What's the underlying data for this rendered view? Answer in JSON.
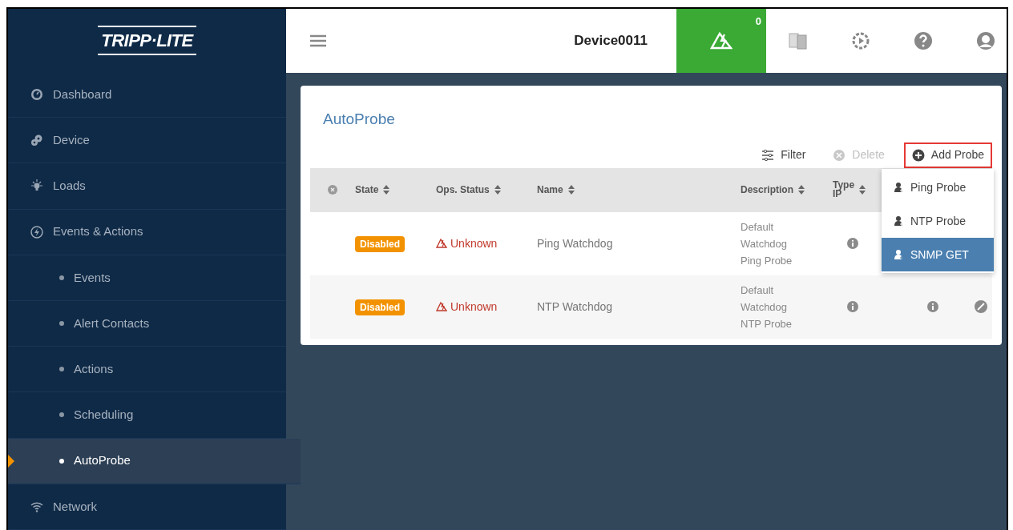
{
  "logo": "TRIPP·LITE",
  "sidebar": {
    "items": [
      {
        "label": "Dashboard",
        "kind": "top",
        "selected": false
      },
      {
        "label": "Device",
        "kind": "top",
        "selected": false
      },
      {
        "label": "Loads",
        "kind": "top",
        "selected": false
      },
      {
        "label": "Events & Actions",
        "kind": "top",
        "selected": false
      },
      {
        "label": "Events",
        "kind": "sub",
        "selected": false
      },
      {
        "label": "Alert Contacts",
        "kind": "sub",
        "selected": false
      },
      {
        "label": "Actions",
        "kind": "sub",
        "selected": false
      },
      {
        "label": "Scheduling",
        "kind": "sub",
        "selected": false
      },
      {
        "label": "AutoProbe",
        "kind": "sub",
        "selected": true
      },
      {
        "label": "Network",
        "kind": "top",
        "selected": false
      }
    ]
  },
  "header": {
    "device": "Device0011",
    "alarm_count": "0"
  },
  "card": {
    "title": "AutoProbe",
    "toolbar": [
      {
        "label": "Filter",
        "kind": "filter",
        "disabled": false,
        "highlighted": false
      },
      {
        "label": "Delete",
        "kind": "delete",
        "disabled": true,
        "highlighted": false
      },
      {
        "label": "Add Probe",
        "kind": "add",
        "disabled": false,
        "highlighted": true
      }
    ],
    "columns": [
      {
        "lines": [
          "State"
        ]
      },
      {
        "lines": [
          "Ops. Status"
        ]
      },
      {
        "lines": [
          "Name"
        ]
      },
      {
        "lines": [
          "Description"
        ]
      },
      {
        "lines": [
          "Type",
          "IP"
        ]
      }
    ],
    "rows": [
      {
        "state": "Disabled",
        "status": "Unknown",
        "name": "Ping Watchdog",
        "description": [
          "Default",
          "Watchdog",
          "Ping Probe"
        ],
        "cells": [
          {
            "kind": "info"
          }
        ]
      },
      {
        "state": "Disabled",
        "status": "Unknown",
        "name": "NTP Watchdog",
        "description": [
          "Default",
          "Watchdog",
          "NTP Probe"
        ],
        "cells": [
          {
            "kind": "info"
          },
          {
            "kind": "info"
          },
          {
            "kind": "block"
          }
        ]
      }
    ],
    "menu": [
      {
        "label": "Ping Probe",
        "selected": false
      },
      {
        "label": "NTP Probe",
        "selected": false
      },
      {
        "label": "SNMP GET",
        "selected": true
      }
    ]
  }
}
